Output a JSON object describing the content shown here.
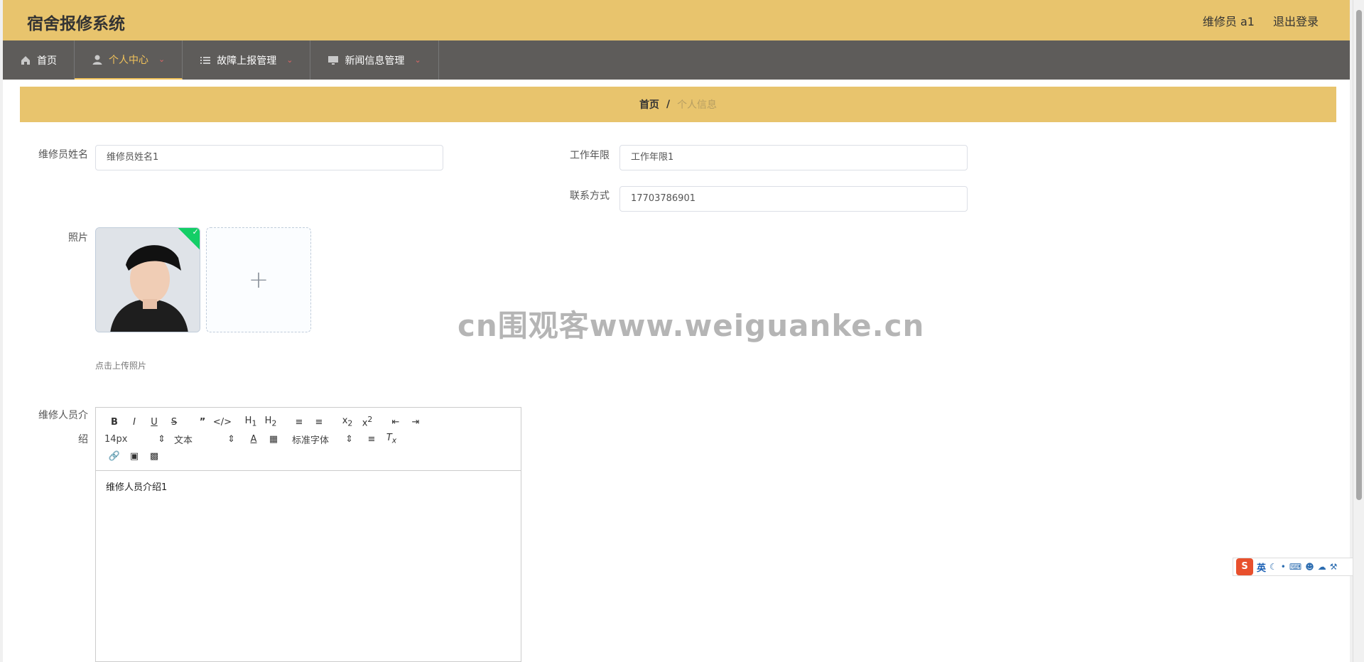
{
  "header": {
    "title": "宿舍报修系统",
    "user_label": "维修员 a1",
    "logout_label": "退出登录"
  },
  "nav": {
    "items": [
      {
        "label": "首页",
        "icon": "home-icon",
        "active": false,
        "dropdown": false
      },
      {
        "label": "个人中心",
        "icon": "user-icon",
        "active": true,
        "dropdown": true
      },
      {
        "label": "故障上报管理",
        "icon": "list-icon",
        "active": false,
        "dropdown": true
      },
      {
        "label": "新闻信息管理",
        "icon": "monitor-icon",
        "active": false,
        "dropdown": true
      }
    ]
  },
  "breadcrumb": {
    "home": "首页",
    "separator": "/",
    "current": "个人信息"
  },
  "form": {
    "name_label": "维修员姓名",
    "name_value": "维修员姓名1",
    "years_label": "工作年限",
    "years_value": "工作年限1",
    "contact_label": "联系方式",
    "contact_value": "17703786901",
    "photo_label": "照片",
    "upload_tip": "点击上传照片",
    "intro_label": "维修人员介绍"
  },
  "editor": {
    "font_size": "14px",
    "heading": "文本",
    "font_family": "标准字体",
    "content": "维修人员介绍1"
  },
  "watermark": "cn围观客www.weiguanke.cn",
  "ime": {
    "logo": "S",
    "lang": "英"
  },
  "colors": {
    "header_bg": "#e8c46d",
    "nav_bg": "#5e5c5a",
    "active_nav": "#f2c35a",
    "check": "#13ce66"
  }
}
